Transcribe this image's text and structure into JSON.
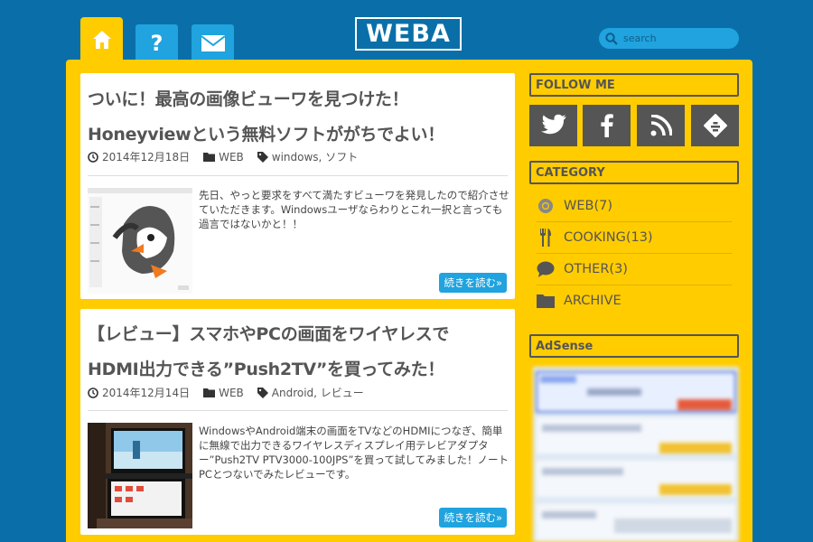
{
  "header": {
    "logo_text": "WEBA",
    "help_glyph": "?",
    "search_placeholder": "search",
    "icons": [
      "home-icon",
      "question-icon",
      "mail-icon",
      "search-icon"
    ]
  },
  "posts": [
    {
      "title_line1": "ついに！最高の画像ビューワを見つけた！",
      "title_line2": "Honeyviewという無料ソフトががちでよい！",
      "date": "2014年12月18日",
      "category": "WEB",
      "tags": "windows, ソフト",
      "excerpt": "先日、やっと要求をすべて満たすビューワを発見したので紹介させていただきます。Windowsユーザならわりとこれ一択と言っても過言ではないかと！！",
      "more_label": "続きを読む»"
    },
    {
      "title_line1": "【レビュー】スマホやPCの画面をワイヤレスで",
      "title_line2": "HDMI出力できる”Push2TV”を買ってみた！",
      "date": "2014年12月14日",
      "category": "WEB",
      "tags": "Android, レビュー",
      "excerpt": "WindowsやAndroid端末の画面をTVなどのHDMIにつなぎ、簡単に無線で出力できるワイヤレスディスプレイ用テレビアダプター”Push2TV PTV3000-100JPS”を買って試してみました！ノートPCとつないでみたレビューです。",
      "more_label": "続きを読む»"
    }
  ],
  "sidebar": {
    "follow_heading": "FOLLOW ME",
    "social_icons": [
      "twitter-icon",
      "facebook-icon",
      "rss-icon",
      "feedly-icon"
    ],
    "category_heading": "CATEGORY",
    "categories": [
      {
        "label": "WEB(7)",
        "icon": "chrome-icon"
      },
      {
        "label": "COOKING(13)",
        "icon": "cutlery-icon"
      },
      {
        "label": "OTHER(3)",
        "icon": "speech-bubble-icon"
      },
      {
        "label": "ARCHIVE",
        "icon": "folder-icon"
      }
    ],
    "adsense_heading": "AdSense"
  },
  "colors": {
    "background": "#0a6fa8",
    "accent_yellow": "#ffcc00",
    "accent_blue": "#20a3de",
    "text_gray": "#555555"
  }
}
